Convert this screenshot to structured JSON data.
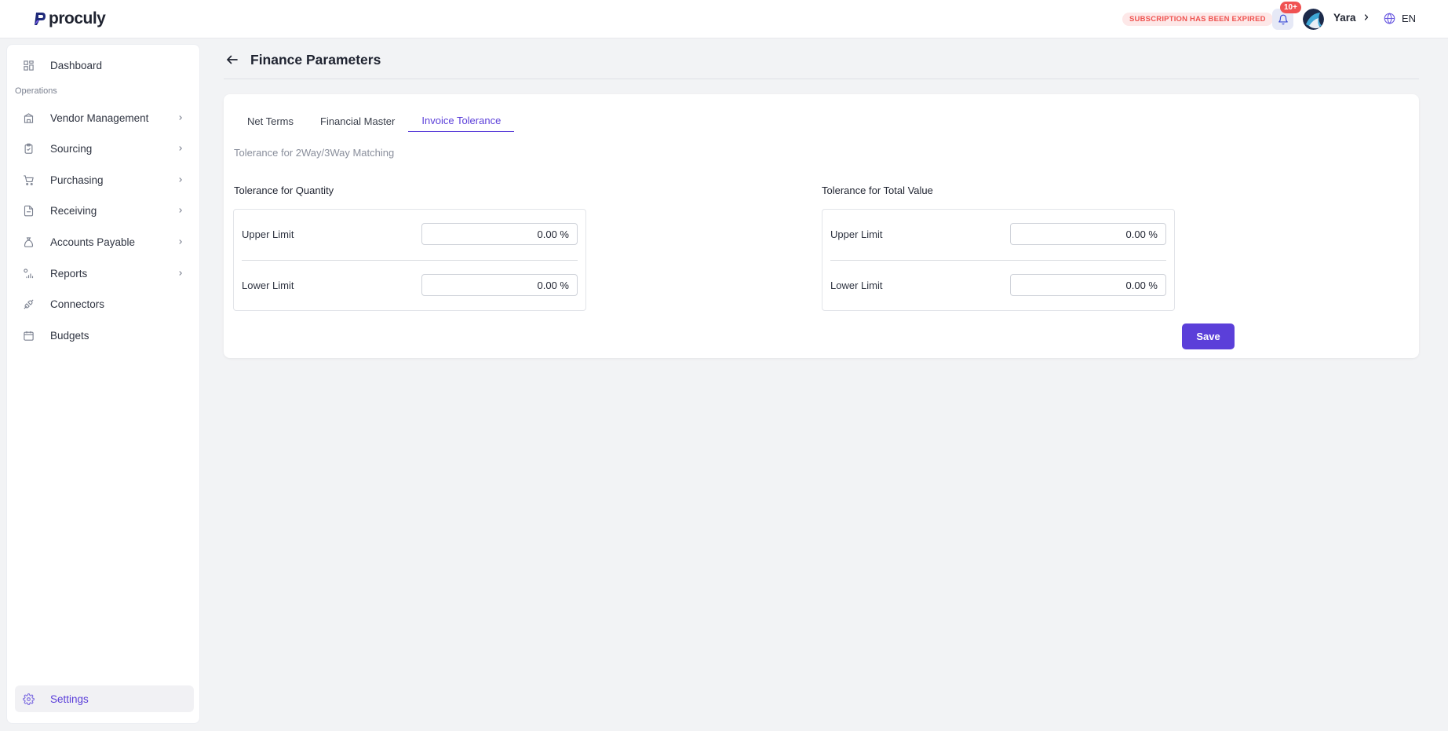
{
  "app": {
    "logo_text": "proculy",
    "subscription_status": "SUBSCRIPTION HAS BEEN EXPIRED",
    "notification_count": "10+",
    "user_name": "Yara",
    "language": "EN",
    "accent_color": "#5b3fd9"
  },
  "sidebar": {
    "dashboard": "Dashboard",
    "section_label": "Operations",
    "items": [
      {
        "label": "Vendor Management",
        "icon": "building-icon"
      },
      {
        "label": "Sourcing",
        "icon": "clipboard-icon"
      },
      {
        "label": "Purchasing",
        "icon": "cart-icon"
      },
      {
        "label": "Receiving",
        "icon": "document-icon"
      },
      {
        "label": "Accounts Payable",
        "icon": "money-bag-icon"
      },
      {
        "label": "Reports",
        "icon": "chart-icon"
      },
      {
        "label": "Connectors",
        "icon": "plug-icon"
      },
      {
        "label": "Budgets",
        "icon": "calendar-icon"
      }
    ],
    "settings": "Settings"
  },
  "page": {
    "title": "Finance Parameters"
  },
  "tabs": [
    {
      "label": "Net Terms"
    },
    {
      "label": "Financial Master"
    },
    {
      "label": "Invoice Tolerance",
      "active": true
    }
  ],
  "tolerance": {
    "description": "Tolerance for 2Way/3Way Matching",
    "quantity": {
      "title": "Tolerance for Quantity",
      "upper_label": "Upper Limit",
      "upper_value": "0.00 %",
      "lower_label": "Lower Limit",
      "lower_value": "0.00 %"
    },
    "total_value": {
      "title": "Tolerance for Total Value",
      "upper_label": "Upper Limit",
      "upper_value": "0.00 %",
      "lower_label": "Lower Limit",
      "lower_value": "0.00 %"
    },
    "save_label": "Save"
  }
}
